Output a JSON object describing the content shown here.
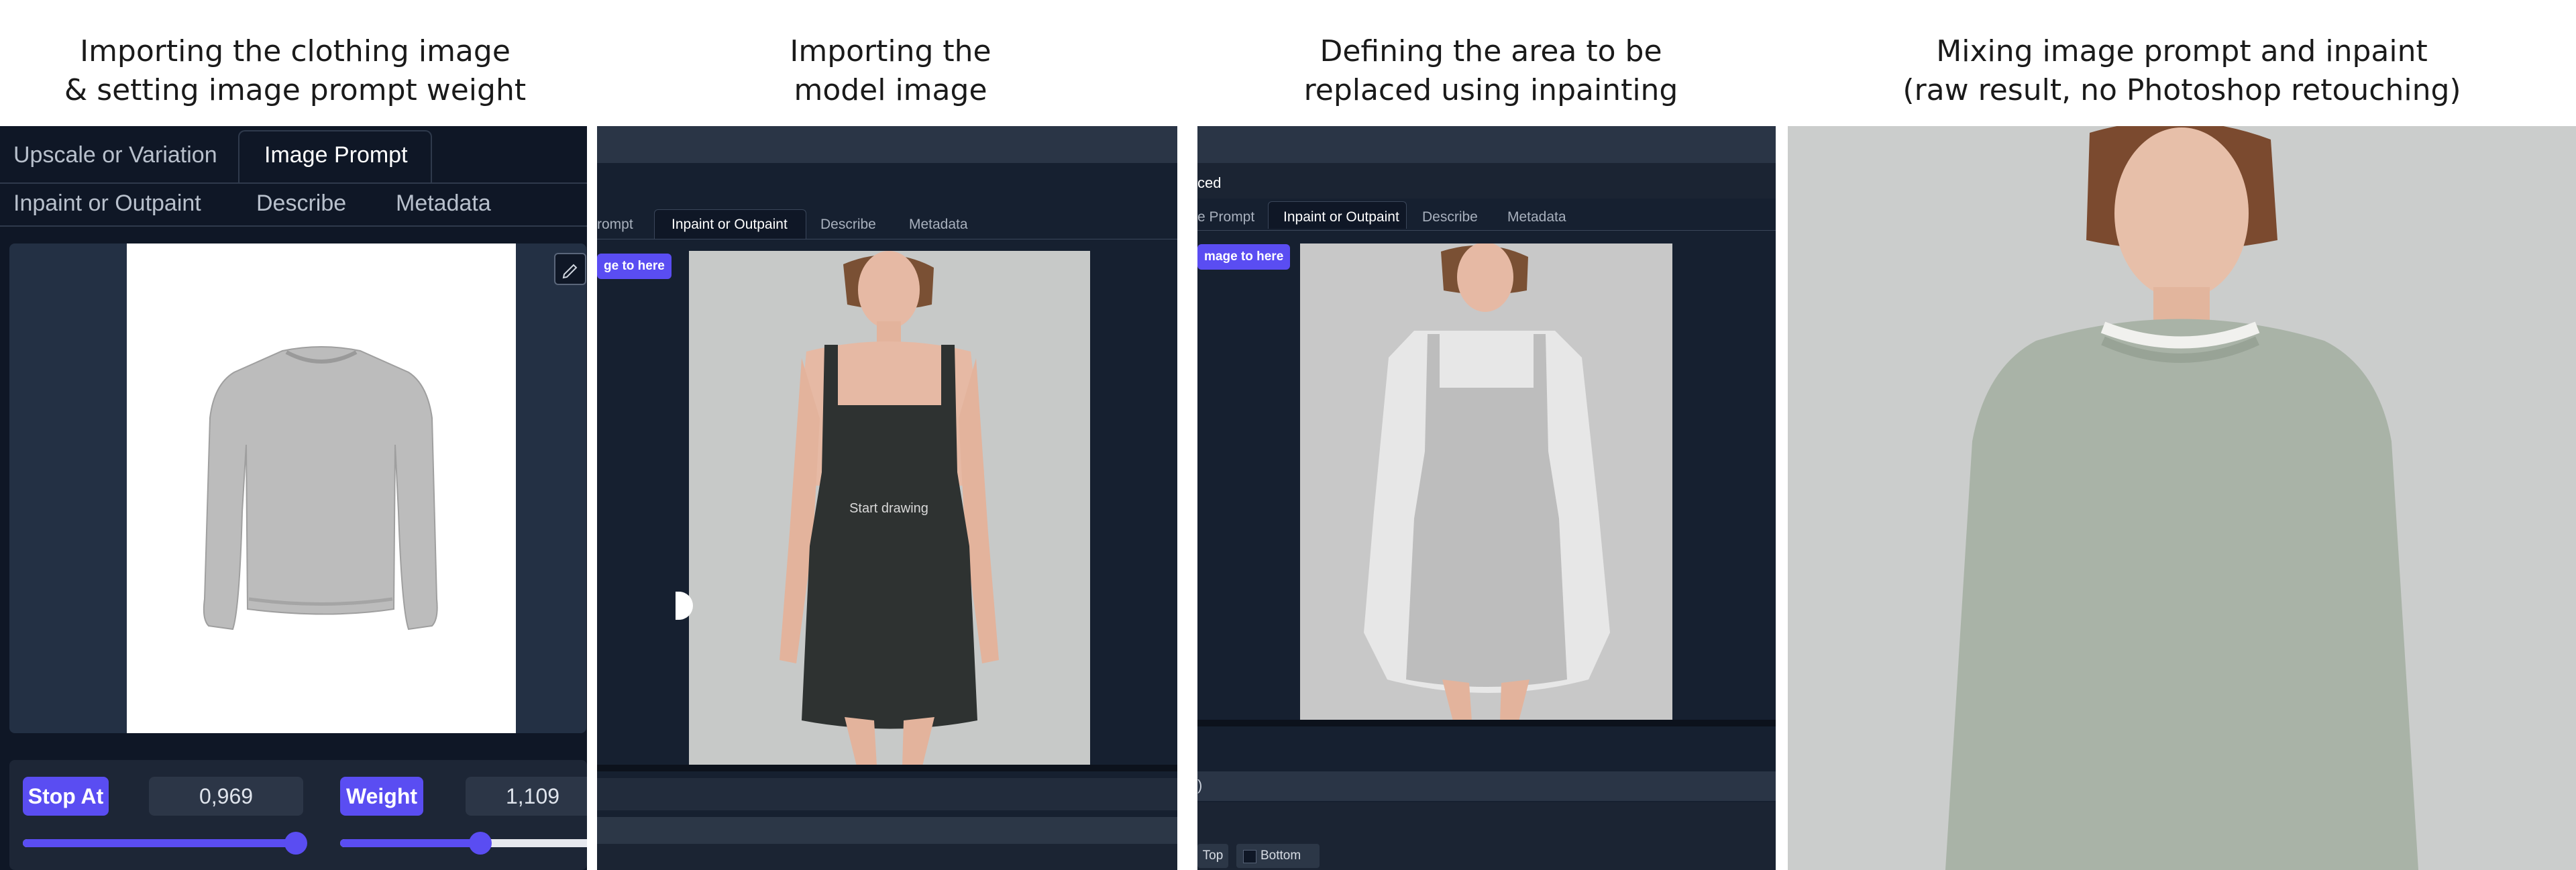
{
  "captions": [
    {
      "line1": "Importing the clothing image",
      "line2": "& setting image prompt weight"
    },
    {
      "line1": "Importing the",
      "line2": "model image"
    },
    {
      "line1": "Defining the area to be",
      "line2": "replaced using inpainting"
    },
    {
      "line1": "Mixing image prompt and inpaint",
      "line2": "(raw result, no Photoshop retouching)"
    }
  ],
  "panel1": {
    "tabs": {
      "upscale": "Upscale or Variation",
      "image_prompt": "Image Prompt",
      "inpaint": "Inpaint or Outpaint",
      "describe": "Describe",
      "metadata": "Metadata"
    },
    "controls": {
      "stop_at_label": "Stop At",
      "stop_at_value": "0,969",
      "weight_label": "Weight",
      "weight_value": "1,109",
      "stop_at_fraction": 0.969,
      "weight_fraction": 0.55
    }
  },
  "panel2": {
    "tabs": {
      "prompt": "rompt",
      "inpaint": "Inpaint or Outpaint",
      "describe": "Describe",
      "metadata": "Metadata"
    },
    "drop_badge": "ge to here",
    "canvas_hint": "Start drawing"
  },
  "panel3": {
    "header_fragment": "ced",
    "tabs": {
      "prompt": "e Prompt",
      "inpaint": "Inpaint or Outpaint",
      "describe": "Describe",
      "metadata": "Metadata"
    },
    "drop_badge": "mage to here",
    "paren": ")",
    "options": {
      "top": "Top",
      "bottom": "Bottom"
    }
  },
  "colors": {
    "accent": "#5a4df2",
    "panel_bg": "#1b2433",
    "sweater": "#a9b3a7"
  }
}
